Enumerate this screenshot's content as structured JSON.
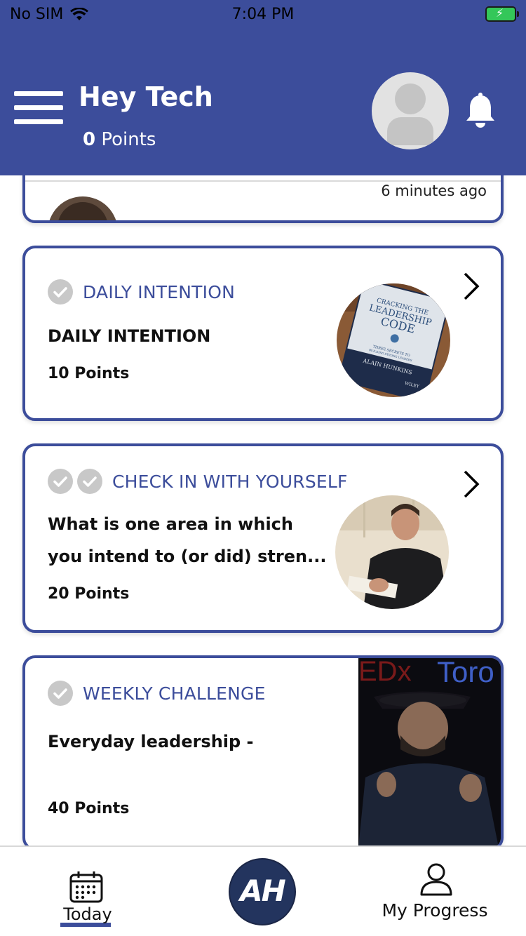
{
  "status_bar": {
    "carrier": "No SIM",
    "time": "7:04 PM"
  },
  "header": {
    "greeting": "Hey Tech",
    "points_value": "0",
    "points_label": "Points",
    "accent_color": "#3c4d9b"
  },
  "feed": {
    "partial_card": {
      "timestamp": "6 minutes ago"
    },
    "cards": [
      {
        "type": "DAILY INTENTION",
        "title": "DAILY INTENTION",
        "points": "10 Points",
        "checks": 1,
        "thumbnail": "book-cover-leadership-code",
        "book_text": [
          "CRACKING THE",
          "LEADERSHIP",
          "CODE",
          "THREE SECRETS TO",
          "BUILDING STRONG LEADERS",
          "ALAIN HUNKINS",
          "WILEY"
        ]
      },
      {
        "type": "CHECK IN WITH YOURSELF",
        "title_line1": "What is one area in which",
        "title_line2": "you intend to (or did) stren...",
        "points": "20 Points",
        "checks": 2,
        "thumbnail": "author-signing-photo"
      },
      {
        "type": "WEEKLY CHALLENGE",
        "title": "Everyday leadership -",
        "points": "40 Points",
        "checks": 1,
        "thumbnail": "speaker-stage-video",
        "video_text": "Toro"
      }
    ]
  },
  "tabbar": {
    "today_label": "Today",
    "home_logo": "AH",
    "progress_label": "My Progress"
  }
}
